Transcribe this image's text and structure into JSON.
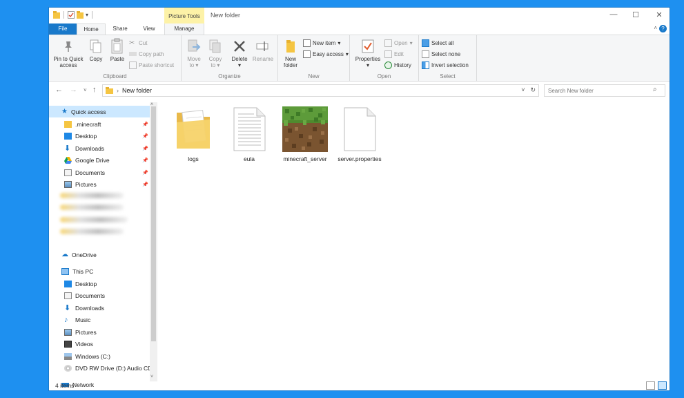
{
  "window": {
    "title": "New folder",
    "context_tab_group": "Picture Tools"
  },
  "tabs": {
    "file": "File",
    "home": "Home",
    "share": "Share",
    "view": "View",
    "manage": "Manage"
  },
  "ribbon": {
    "clipboard": {
      "label": "Clipboard",
      "pin": "Pin to Quick access",
      "pin_line1": "Pin to Quick",
      "pin_line2": "access",
      "copy": "Copy",
      "paste": "Paste",
      "cut": "Cut",
      "copy_path": "Copy path",
      "paste_shortcut": "Paste shortcut"
    },
    "organize": {
      "label": "Organize",
      "move_to_line1": "Move",
      "move_to_line2": "to",
      "copy_to_line1": "Copy",
      "copy_to_line2": "to",
      "delete": "Delete",
      "rename": "Rename"
    },
    "new": {
      "label": "New",
      "new_folder_line1": "New",
      "new_folder_line2": "folder",
      "new_item": "New item",
      "easy_access": "Easy access"
    },
    "open": {
      "label": "Open",
      "properties": "Properties",
      "open": "Open",
      "edit": "Edit",
      "history": "History"
    },
    "select": {
      "label": "Select",
      "select_all": "Select all",
      "select_none": "Select none",
      "invert": "Invert selection"
    }
  },
  "address": {
    "path": "New folder",
    "search_placeholder": "Search New folder"
  },
  "sidebar": {
    "quick_access": "Quick access",
    "pinned": [
      {
        "label": ".minecraft"
      },
      {
        "label": "Desktop"
      },
      {
        "label": "Downloads"
      },
      {
        "label": "Google Drive"
      },
      {
        "label": "Documents"
      },
      {
        "label": "Pictures"
      }
    ],
    "onedrive": "OneDrive",
    "this_pc": "This PC",
    "pc_items": [
      {
        "label": "Desktop"
      },
      {
        "label": "Documents"
      },
      {
        "label": "Downloads"
      },
      {
        "label": "Music"
      },
      {
        "label": "Pictures"
      },
      {
        "label": "Videos"
      },
      {
        "label": "Windows (C:)"
      },
      {
        "label": "DVD RW Drive (D:) Audio CD"
      }
    ],
    "network": "Network"
  },
  "files": [
    {
      "name": "logs",
      "type": "folder"
    },
    {
      "name": "eula",
      "type": "text-document"
    },
    {
      "name": "minecraft_server",
      "type": "minecraft-grass-block"
    },
    {
      "name": "server.properties",
      "type": "blank-document"
    }
  ],
  "status": {
    "item_count": "4 items"
  },
  "colors": {
    "accent": "#1979ca",
    "desktop": "#1e90f0",
    "selection": "#cce8ff",
    "context_tab": "#fdf2a7"
  }
}
